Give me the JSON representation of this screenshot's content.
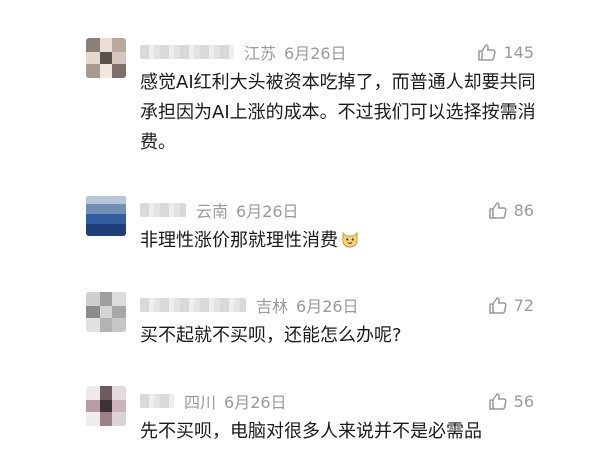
{
  "comments": [
    {
      "location": "江苏",
      "date": "6月26日",
      "likes": "145",
      "text": "感觉AI红利大头被资本吃掉了，而普通人却要共同承担因为AI上涨的成本。不过我们可以选择按需消费。"
    },
    {
      "location": "云南",
      "date": "6月26日",
      "likes": "86",
      "text": "非理性涨价那就理性消费",
      "emoji": "cat-face-icon"
    },
    {
      "location": "吉林",
      "date": "6月26日",
      "likes": "72",
      "text": "买不起就不买呗，还能怎么办呢?"
    },
    {
      "location": "四川",
      "date": "6月26日",
      "likes": "56",
      "text": "先不买呗，电脑对很多人来说并不是必需品"
    }
  ]
}
